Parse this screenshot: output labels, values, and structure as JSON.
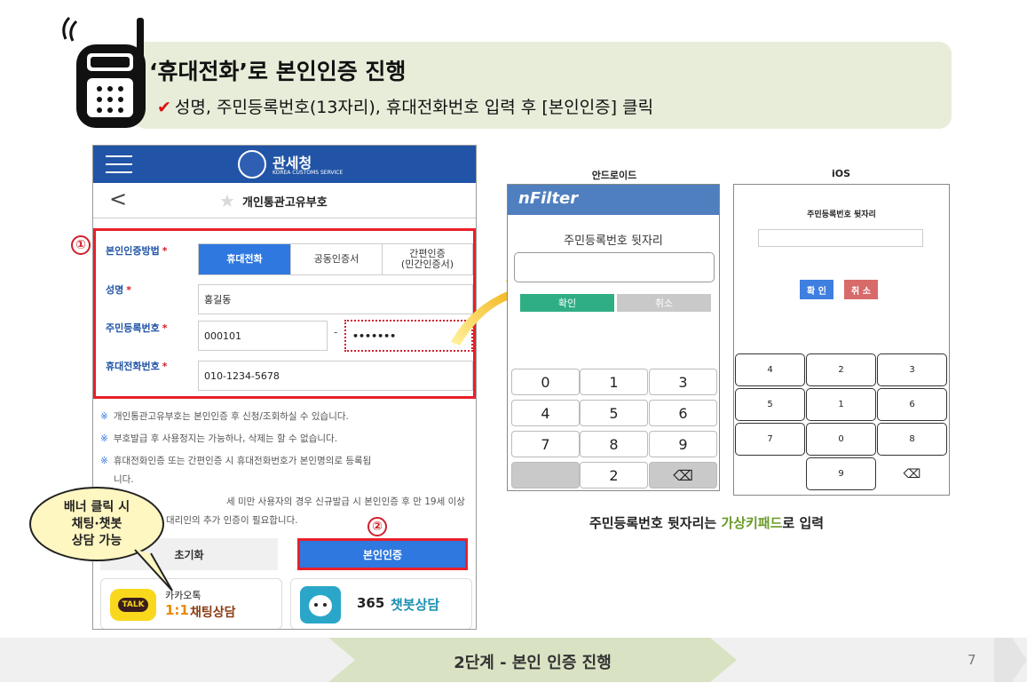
{
  "header": {
    "title": "‘휴대전화’로 본인인증 진행",
    "check": "✔",
    "subtitle": "성명, 주민등록번호(13자리), 휴대전화번호 입력 후 [본인인증] 클릭"
  },
  "mobile": {
    "brand": "관세청",
    "brand_sub": "KOREA CUSTOMS SERVICE",
    "back": "<",
    "page_title": "개인통관고유부호",
    "auth_method_label": "본인인증방법",
    "required_mark": "*",
    "tabs": [
      "휴대전화",
      "공동인증서",
      "간편인증",
      "(민간인증서)"
    ],
    "name_label": "성명",
    "name_value": "홍길동",
    "rrn_label": "주민등록번호",
    "rrn_front": "000101",
    "rrn_dash": "-",
    "rrn_back": "•••••••",
    "phone_label": "휴대전화번호",
    "phone_value": "010-1234-5678",
    "note_mark": "※",
    "notes": [
      "개인통관고유부호는 본인인증 후 신청/조회하실 수 있습니다.",
      "부호발급 후 사용정지는 가능하나, 삭제는 할 수 없습니다.",
      "휴대전화인증 또는 간편인증 시 휴대전화번호가 본인명의로 등록됩",
      "니다.",
      "세 미만 사용자의 경우 신규발급 시 본인인증 후 만 19세 이상",
      "대리인의 추가 인증이 필요합니다."
    ],
    "reset_button": "초기화",
    "cert_button": "본인인증",
    "kakao_top": "카카오톡",
    "kakao_num": "1:1",
    "kakao_text": "채팅상담",
    "kakao_icon": "TALK",
    "chatbot_num": "365",
    "chatbot_text": "챗봇상담"
  },
  "markers": {
    "one": "①",
    "two": "②"
  },
  "bubble": {
    "line1": "배너 클릭 시",
    "line2": "채팅·챗봇",
    "line3": "상담 가능"
  },
  "android": {
    "heading": "안드로이드",
    "brand": "nFilter",
    "label": "주민등록번호 뒷자리",
    "ok": "확인",
    "cancel": "취소",
    "keys": [
      "0",
      "1",
      "3",
      "4",
      "5",
      "6",
      "7",
      "8",
      "9",
      "",
      "2",
      "⌫"
    ]
  },
  "ios": {
    "heading": "iOS",
    "label": "주민등록번호 뒷자리",
    "ok": "확 인",
    "cancel": "취 소",
    "keys": [
      "4",
      "2",
      "3",
      "5",
      "1",
      "6",
      "7",
      "0",
      "8",
      "",
      "9",
      "⌫"
    ]
  },
  "caption": {
    "pre": "주민등록번호 뒷자리는 ",
    "highlight": "가상키패드",
    "post": "로 입력"
  },
  "footer": {
    "step": "2단계 - 본인 인증 진행",
    "page": "7"
  },
  "colors": {
    "banner": "#e7edd9",
    "navy": "#2154a6",
    "blue": "#2f78e0",
    "red": "#e8202a",
    "green_hl": "#6b9a2a",
    "android_bar": "#4f7fbf",
    "android_ok": "#2fae86"
  }
}
